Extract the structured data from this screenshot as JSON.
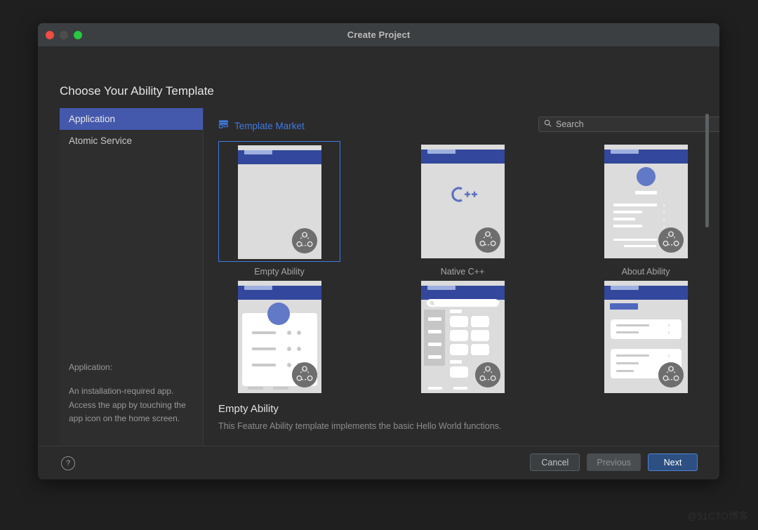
{
  "window": {
    "title": "Create Project",
    "traffic_lights": [
      "close",
      "minimize",
      "zoom"
    ]
  },
  "heading": "Choose Your Ability Template",
  "sidebar": {
    "items": [
      {
        "label": "Application",
        "selected": true
      },
      {
        "label": "Atomic Service",
        "selected": false
      }
    ],
    "description_title": "Application:",
    "description_body": "An installation-required app. Access the app by touching the app icon on the home screen."
  },
  "content": {
    "market_link": "Template Market",
    "market_icon": "store-icon",
    "search": {
      "placeholder": "Search",
      "value": "",
      "search_icon": "search-icon",
      "clear_icon": "close-icon"
    },
    "templates": [
      {
        "label": "Empty Ability",
        "selected": true,
        "kind": "empty"
      },
      {
        "label": "Native C++",
        "selected": false,
        "kind": "cpp",
        "logo_text": "C++"
      },
      {
        "label": "About Ability",
        "selected": false,
        "kind": "about"
      },
      {
        "label": "",
        "selected": false,
        "kind": "profile"
      },
      {
        "label": "",
        "selected": false,
        "kind": "catalog"
      },
      {
        "label": "",
        "selected": false,
        "kind": "settings"
      }
    ],
    "selected_template": {
      "title": "Empty Ability",
      "subtitle": "This Feature Ability template implements the basic Hello World functions."
    }
  },
  "footer": {
    "help_icon": "help-icon",
    "help_glyph": "?",
    "buttons": [
      {
        "label": "Cancel",
        "style": "normal"
      },
      {
        "label": "Previous",
        "style": "disabled"
      },
      {
        "label": "Next",
        "style": "primary"
      }
    ]
  },
  "watermark": "@51CTO博客",
  "colors": {
    "accent_blue": "#3f7ae0",
    "selection_blue": "#4458ac",
    "phone_header_blue": "#33489c",
    "window_bg": "#2b2b2b",
    "titlebar_bg": "#3c3f41"
  }
}
